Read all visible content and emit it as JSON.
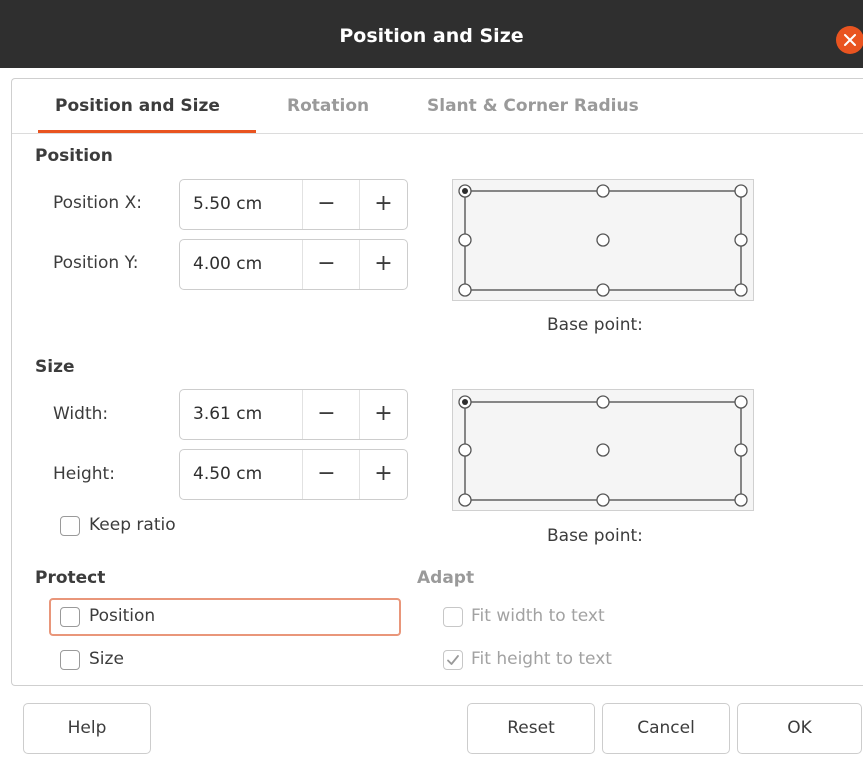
{
  "window": {
    "title": "Position and Size",
    "close_icon": "close-icon"
  },
  "tabs": [
    {
      "label": "Position and Size",
      "active": true
    },
    {
      "label": "Rotation",
      "active": false
    },
    {
      "label": "Slant & Corner Radius",
      "active": false
    }
  ],
  "position": {
    "heading": "Position",
    "x": {
      "label": "Position X:",
      "value": "5.50 cm"
    },
    "y": {
      "label": "Position Y:",
      "value": "4.00 cm"
    },
    "base_point_label": "Base point:",
    "base_point_selected": "top-left"
  },
  "size": {
    "heading": "Size",
    "width": {
      "label": "Width:",
      "value": "3.61 cm"
    },
    "height": {
      "label": "Height:",
      "value": "4.50 cm"
    },
    "keep_ratio": {
      "label": "Keep ratio",
      "checked": false
    },
    "base_point_label": "Base point:",
    "base_point_selected": "top-left"
  },
  "protect": {
    "heading": "Protect",
    "position": {
      "label": "Position",
      "checked": false
    },
    "size": {
      "label": "Size",
      "checked": false
    }
  },
  "adapt": {
    "heading": "Adapt",
    "fit_width": {
      "label": "Fit width to text",
      "checked": false,
      "enabled": false
    },
    "fit_height": {
      "label": "Fit height to text",
      "checked": true,
      "enabled": false
    }
  },
  "spin_glyphs": {
    "minus": "−",
    "plus": "+"
  },
  "buttons": {
    "help": "Help",
    "reset": "Reset",
    "cancel": "Cancel",
    "ok": "OK"
  },
  "colors": {
    "accent": "#e95420",
    "titlebar": "#2f2f2f",
    "focus": "#e9967a"
  }
}
